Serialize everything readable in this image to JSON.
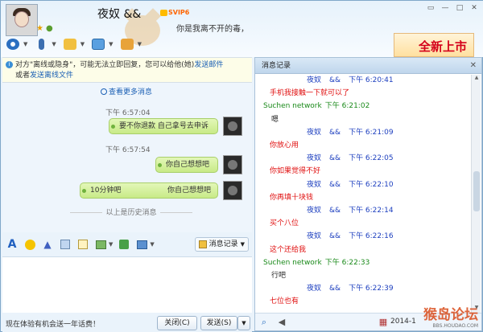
{
  "header": {
    "nickname": "夜奴 &&",
    "vip_badge": "SVIP6",
    "signature": "你是我离不开的毒，",
    "ad_text": "全新上市"
  },
  "toolbar": {
    "icons": [
      "camera-icon",
      "mic-icon",
      "folder-icon",
      "screen-share-icon",
      "app-icon"
    ]
  },
  "notice": {
    "text_before": "对方\"离线或隐身\"，可能无法立即回复，您可以给他(她)",
    "link1": "发送邮件",
    "text_middle": "或者",
    "link2": "发送离线文件"
  },
  "chat": {
    "more_link": "查看更多消息",
    "messages": [
      {
        "time": "下午 6:57:04",
        "text": "要不你退款 自己拿号去申诉"
      },
      {
        "time": "下午 6:57:54",
        "text": "你自己想想吧"
      },
      {
        "time": "",
        "text": "你自己想想吧"
      },
      {
        "time": "",
        "text": "10分钟吧"
      }
    ],
    "history_divider": "以上是历史消息"
  },
  "input_toolbar": {
    "history_button": "消息记录"
  },
  "bottom": {
    "promo": "现在体验有机会送一年话费！",
    "close_button": "关闭(C)",
    "send_button": "发送(S)"
  },
  "records": {
    "title": "消息记录",
    "entries": [
      {
        "kind": "hdr-me",
        "name": "夜奴",
        "tag": "&&",
        "time": "下午 6:20:41"
      },
      {
        "kind": "msg-me",
        "text": "手机我接触一下就可以了"
      },
      {
        "kind": "hdr-other",
        "name": "Suchen network",
        "time": "下午 6:21:02"
      },
      {
        "kind": "msg-other",
        "text": "嗯"
      },
      {
        "kind": "hdr-me",
        "name": "夜奴",
        "tag": "&&",
        "time": "下午 6:21:09"
      },
      {
        "kind": "msg-me",
        "text": "你放心用"
      },
      {
        "kind": "hdr-me",
        "name": "夜奴",
        "tag": "&&",
        "time": "下午 6:22:05"
      },
      {
        "kind": "msg-me",
        "text": "你如果觉得不好"
      },
      {
        "kind": "hdr-me",
        "name": "夜奴",
        "tag": "&&",
        "time": "下午 6:22:10"
      },
      {
        "kind": "msg-me",
        "text": "你再填十块钱"
      },
      {
        "kind": "hdr-me",
        "name": "夜奴",
        "tag": "&&",
        "time": "下午 6:22:14"
      },
      {
        "kind": "msg-me",
        "text": "买个八位"
      },
      {
        "kind": "hdr-me",
        "name": "夜奴",
        "tag": "&&",
        "time": "下午 6:22:16"
      },
      {
        "kind": "msg-me",
        "text": "这个还给我"
      },
      {
        "kind": "hdr-other",
        "name": "Suchen network",
        "time": "下午 6:22:33"
      },
      {
        "kind": "msg-other",
        "text": "行吧"
      },
      {
        "kind": "hdr-me",
        "name": "夜奴",
        "tag": "&&",
        "time": "下午 6:22:39"
      },
      {
        "kind": "msg-me",
        "text": "七位也有"
      }
    ],
    "footer_date": "2014-1",
    "watermark": "猴岛论坛",
    "watermark_url": "BBS.HOUDAO.COM"
  }
}
